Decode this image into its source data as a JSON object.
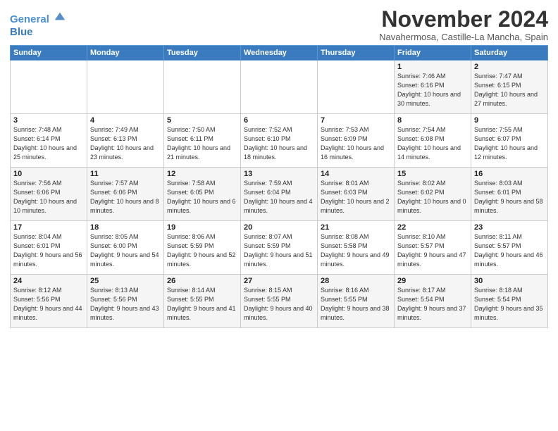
{
  "header": {
    "logo_line1": "General",
    "logo_line2": "Blue",
    "month": "November 2024",
    "location": "Navahermosa, Castille-La Mancha, Spain"
  },
  "weekdays": [
    "Sunday",
    "Monday",
    "Tuesday",
    "Wednesday",
    "Thursday",
    "Friday",
    "Saturday"
  ],
  "weeks": [
    [
      {
        "day": "",
        "info": ""
      },
      {
        "day": "",
        "info": ""
      },
      {
        "day": "",
        "info": ""
      },
      {
        "day": "",
        "info": ""
      },
      {
        "day": "",
        "info": ""
      },
      {
        "day": "1",
        "info": "Sunrise: 7:46 AM\nSunset: 6:16 PM\nDaylight: 10 hours and 30 minutes."
      },
      {
        "day": "2",
        "info": "Sunrise: 7:47 AM\nSunset: 6:15 PM\nDaylight: 10 hours and 27 minutes."
      }
    ],
    [
      {
        "day": "3",
        "info": "Sunrise: 7:48 AM\nSunset: 6:14 PM\nDaylight: 10 hours and 25 minutes."
      },
      {
        "day": "4",
        "info": "Sunrise: 7:49 AM\nSunset: 6:13 PM\nDaylight: 10 hours and 23 minutes."
      },
      {
        "day": "5",
        "info": "Sunrise: 7:50 AM\nSunset: 6:11 PM\nDaylight: 10 hours and 21 minutes."
      },
      {
        "day": "6",
        "info": "Sunrise: 7:52 AM\nSunset: 6:10 PM\nDaylight: 10 hours and 18 minutes."
      },
      {
        "day": "7",
        "info": "Sunrise: 7:53 AM\nSunset: 6:09 PM\nDaylight: 10 hours and 16 minutes."
      },
      {
        "day": "8",
        "info": "Sunrise: 7:54 AM\nSunset: 6:08 PM\nDaylight: 10 hours and 14 minutes."
      },
      {
        "day": "9",
        "info": "Sunrise: 7:55 AM\nSunset: 6:07 PM\nDaylight: 10 hours and 12 minutes."
      }
    ],
    [
      {
        "day": "10",
        "info": "Sunrise: 7:56 AM\nSunset: 6:06 PM\nDaylight: 10 hours and 10 minutes."
      },
      {
        "day": "11",
        "info": "Sunrise: 7:57 AM\nSunset: 6:06 PM\nDaylight: 10 hours and 8 minutes."
      },
      {
        "day": "12",
        "info": "Sunrise: 7:58 AM\nSunset: 6:05 PM\nDaylight: 10 hours and 6 minutes."
      },
      {
        "day": "13",
        "info": "Sunrise: 7:59 AM\nSunset: 6:04 PM\nDaylight: 10 hours and 4 minutes."
      },
      {
        "day": "14",
        "info": "Sunrise: 8:01 AM\nSunset: 6:03 PM\nDaylight: 10 hours and 2 minutes."
      },
      {
        "day": "15",
        "info": "Sunrise: 8:02 AM\nSunset: 6:02 PM\nDaylight: 10 hours and 0 minutes."
      },
      {
        "day": "16",
        "info": "Sunrise: 8:03 AM\nSunset: 6:01 PM\nDaylight: 9 hours and 58 minutes."
      }
    ],
    [
      {
        "day": "17",
        "info": "Sunrise: 8:04 AM\nSunset: 6:01 PM\nDaylight: 9 hours and 56 minutes."
      },
      {
        "day": "18",
        "info": "Sunrise: 8:05 AM\nSunset: 6:00 PM\nDaylight: 9 hours and 54 minutes."
      },
      {
        "day": "19",
        "info": "Sunrise: 8:06 AM\nSunset: 5:59 PM\nDaylight: 9 hours and 52 minutes."
      },
      {
        "day": "20",
        "info": "Sunrise: 8:07 AM\nSunset: 5:59 PM\nDaylight: 9 hours and 51 minutes."
      },
      {
        "day": "21",
        "info": "Sunrise: 8:08 AM\nSunset: 5:58 PM\nDaylight: 9 hours and 49 minutes."
      },
      {
        "day": "22",
        "info": "Sunrise: 8:10 AM\nSunset: 5:57 PM\nDaylight: 9 hours and 47 minutes."
      },
      {
        "day": "23",
        "info": "Sunrise: 8:11 AM\nSunset: 5:57 PM\nDaylight: 9 hours and 46 minutes."
      }
    ],
    [
      {
        "day": "24",
        "info": "Sunrise: 8:12 AM\nSunset: 5:56 PM\nDaylight: 9 hours and 44 minutes."
      },
      {
        "day": "25",
        "info": "Sunrise: 8:13 AM\nSunset: 5:56 PM\nDaylight: 9 hours and 43 minutes."
      },
      {
        "day": "26",
        "info": "Sunrise: 8:14 AM\nSunset: 5:55 PM\nDaylight: 9 hours and 41 minutes."
      },
      {
        "day": "27",
        "info": "Sunrise: 8:15 AM\nSunset: 5:55 PM\nDaylight: 9 hours and 40 minutes."
      },
      {
        "day": "28",
        "info": "Sunrise: 8:16 AM\nSunset: 5:55 PM\nDaylight: 9 hours and 38 minutes."
      },
      {
        "day": "29",
        "info": "Sunrise: 8:17 AM\nSunset: 5:54 PM\nDaylight: 9 hours and 37 minutes."
      },
      {
        "day": "30",
        "info": "Sunrise: 8:18 AM\nSunset: 5:54 PM\nDaylight: 9 hours and 35 minutes."
      }
    ]
  ]
}
